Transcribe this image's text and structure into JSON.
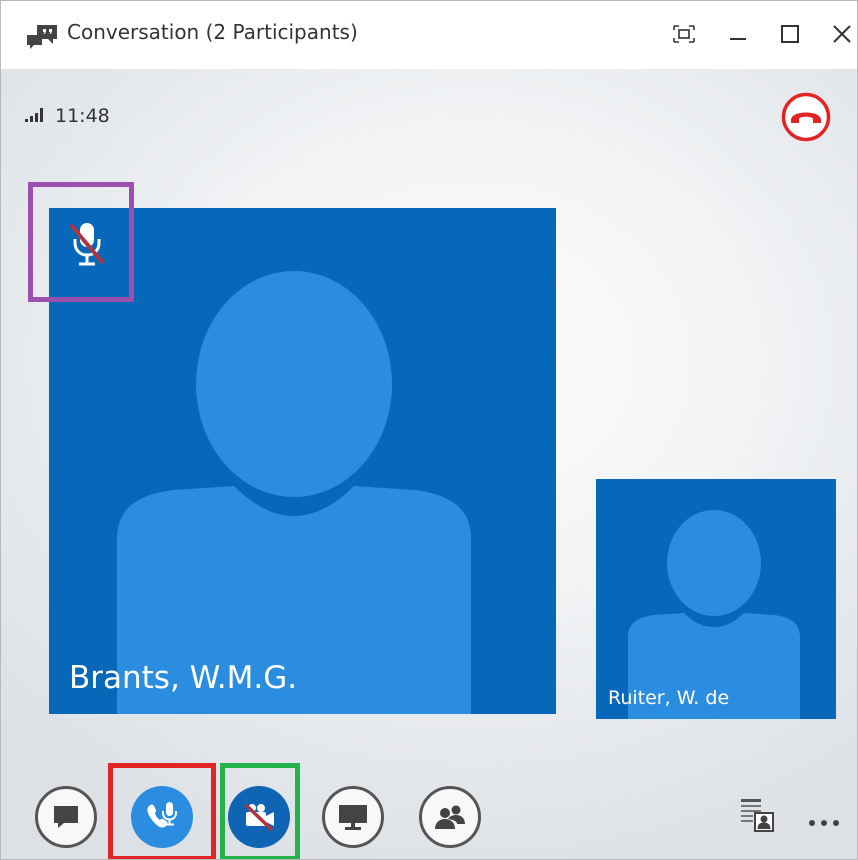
{
  "window": {
    "title": "Conversation (2 Participants)",
    "icons": [
      "conversation-icon",
      "full-screen-icon",
      "minimize-icon",
      "maximize-icon",
      "close-icon"
    ]
  },
  "status": {
    "time": "11:48",
    "signal_icon": "signal-strength-icon"
  },
  "participants": [
    {
      "name": "Brants, W.M.G.",
      "muted": true
    },
    {
      "name": "Ruiter, W. de"
    }
  ],
  "controls": {
    "icons": [
      "im-icon",
      "call-mic-icon",
      "video-muted-icon",
      "present-screen-icon",
      "participants-icon",
      "content-layout-icon",
      "more-options-icon"
    ]
  },
  "colors": {
    "tile_blue": "#0767b9",
    "avatar_blue": "#2b8de0",
    "hangup_red": "#e32424",
    "highlight_purple": "#9b4fae",
    "highlight_red": "#e32424",
    "highlight_green": "#24b24a"
  }
}
